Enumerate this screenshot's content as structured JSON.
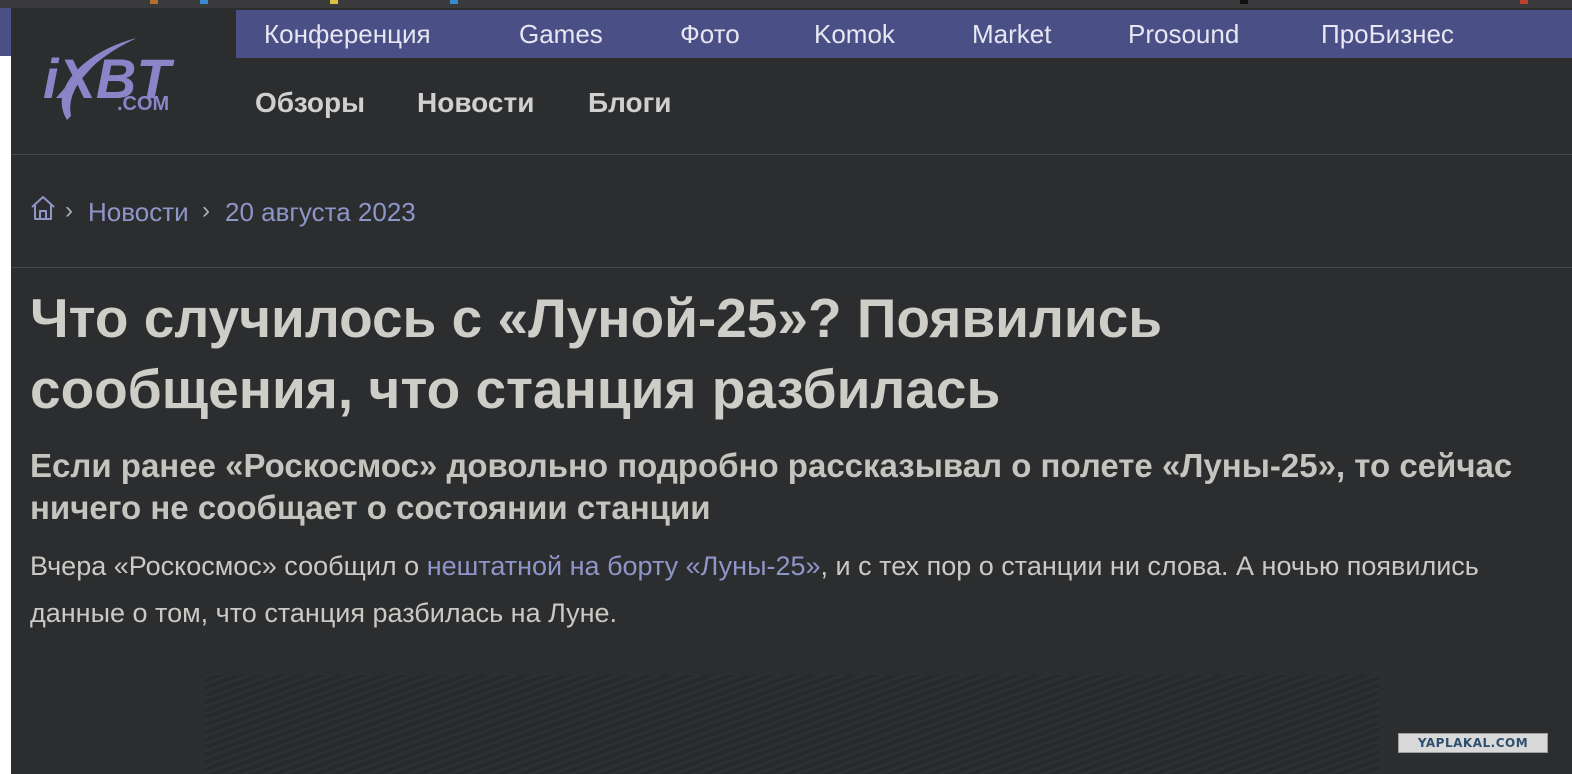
{
  "colors": {
    "page_background": "#2c2d2f",
    "nav_background": "#4a4f86",
    "link": "#8e96c9",
    "headline": "#cfcdc8",
    "logo": "#8c84c8"
  },
  "logo": {
    "text": "iXBT",
    "domain": ".COM",
    "icon": "ixbt-logo-icon"
  },
  "top_nav": {
    "items": [
      {
        "label": "Конференция"
      },
      {
        "label": "Games"
      },
      {
        "label": "Фото"
      },
      {
        "label": "Komok"
      },
      {
        "label": "Market"
      },
      {
        "label": "Prosound"
      },
      {
        "label": "ПроБизнес"
      }
    ]
  },
  "main_nav": {
    "items": [
      {
        "label": "Обзоры"
      },
      {
        "label": "Новости"
      },
      {
        "label": "Блоги"
      }
    ]
  },
  "breadcrumb": {
    "home_icon": "home-icon",
    "separator": "›",
    "items": [
      {
        "label": "Новости"
      },
      {
        "label": "20 августа 2023"
      }
    ]
  },
  "article": {
    "title": "Что случилось с «Луной-25»? Появились сообщения, что станция разбилась",
    "subtitle": "Если ранее «Роскосмос» довольно подробно рассказывал о полете «Луны-25», то сейчас ничего не сообщает о состоянии станции",
    "lead_before_link": "Вчера «Роскосмос» сообщил о ",
    "lead_link": "нештатной на борту «Луны-25»",
    "lead_after_link": ", и с тех пор о станции ни слова. А ночью появились данные о том, что станция разбилась на Луне."
  },
  "watermark": {
    "text": "YAPLAKAL.COM"
  }
}
